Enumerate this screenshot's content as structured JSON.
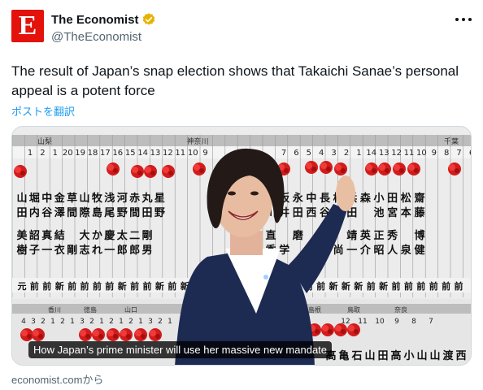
{
  "account": {
    "avatar_letter": "E",
    "display_name": "The Economist",
    "handle": "@TheEconomist",
    "brand_color": "#e3120b",
    "verified_badge": "gold-verified-icon",
    "more_icon": "more-dots-icon"
  },
  "tweet": {
    "text": "The result of Japan’s snap election shows that Takaichi Sanae’s personal appeal is a potent force",
    "translate_label": "ポストを翻訳"
  },
  "card": {
    "caption": "How Japan’s prime minister will use her massive new mandate",
    "source": "economist.comから",
    "image": {
      "board_top_headers": [
        "山梨",
        "神奈川",
        "千葉"
      ],
      "board_top_numbers_left": [
        "1",
        "2",
        "1",
        "20",
        "19",
        "18",
        "17",
        "16",
        "15",
        "14",
        "13",
        "12",
        "11",
        "10",
        "9"
      ],
      "board_top_numbers_right": [
        "7",
        "6",
        "5",
        "4",
        "3",
        "2",
        "1",
        "14",
        "13",
        "12",
        "11",
        "10",
        "9",
        "8",
        "7",
        "6"
      ],
      "board_names_left_row1": [
        "山",
        "堀",
        "中",
        "金",
        "草",
        "山",
        "牧",
        "浅",
        "河",
        "赤",
        "丸",
        "星"
      ],
      "board_names_left_row2": [
        "田",
        "内",
        "谷",
        "澤",
        "間",
        "際",
        "島",
        "尾",
        "野",
        "間",
        "田",
        "野"
      ],
      "board_names_left_row3": [
        "美",
        "詔",
        "真",
        "結",
        "",
        "大",
        "か",
        "慶",
        "太",
        "二",
        "剛",
        "",
        "",
        ""
      ],
      "board_names_left_row4": [
        "樹",
        "子",
        "一",
        "衣",
        "剛",
        "志",
        "れ",
        "一",
        "郎",
        "郎",
        "男",
        "",
        "",
        ""
      ],
      "board_names_right_row1": [
        "古",
        "坂",
        "永",
        "中",
        "長",
        "松",
        "浜",
        "森",
        "小",
        "田",
        "松",
        "齋"
      ],
      "board_names_right_row2": [
        "川",
        "井",
        "田",
        "西",
        "谷",
        "本",
        "田",
        "",
        "池",
        "宮",
        "本",
        "藤"
      ],
      "board_names_right_row3": [
        "直",
        "",
        "磨",
        "",
        "英",
        "",
        "靖",
        "英",
        "正",
        "秀",
        "",
        "博"
      ],
      "board_names_right_row4": [
        "季",
        "学",
        "",
        "",
        "都",
        "尚",
        "一",
        "介",
        "昭",
        "人",
        "泉",
        "健"
      ],
      "board_status_left": [
        "元",
        "前",
        "前",
        "新",
        "前",
        "前",
        "前",
        "前",
        "新",
        "前",
        "前",
        "新",
        "前",
        "新"
      ],
      "board_status_right": [
        "前",
        "新",
        "前",
        "前",
        "前",
        "新",
        "新",
        "新",
        "前",
        "新",
        "前",
        "前",
        "前",
        "前",
        "前",
        "前"
      ],
      "board_bottom_headers": [
        "香川",
        "徳島",
        "山口",
        "島根",
        "鳥取",
        "奈良"
      ],
      "board_bottom_numbers": [
        "4",
        "3",
        "2",
        "1",
        "2",
        "1",
        "3",
        "2",
        "1",
        "2",
        "1",
        "2",
        "1",
        "3",
        "2",
        "1",
        "12",
        "11",
        "10",
        "9",
        "8",
        "7"
      ],
      "board_bottom_names": [
        "高",
        "亀",
        "石",
        "山",
        "田",
        "高",
        "小",
        "山",
        "山",
        "渡",
        "西"
      ],
      "board_color": "#ececec",
      "rose_color": "#d31b1b",
      "jacket_color": "#1d2a52"
    }
  }
}
